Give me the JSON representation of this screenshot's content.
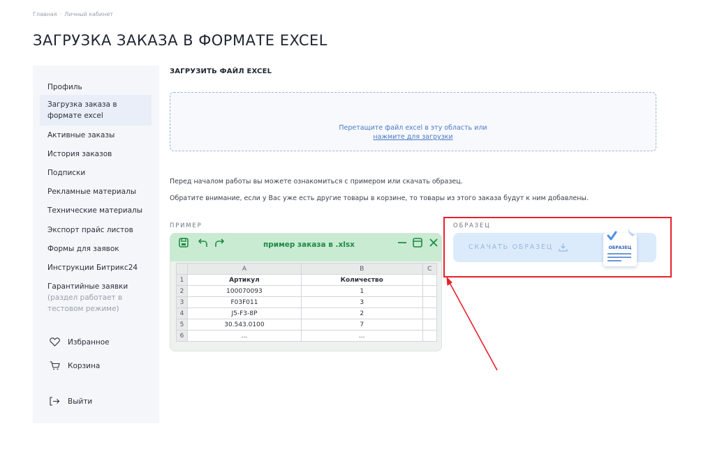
{
  "breadcrumb": {
    "home": "Главная",
    "separator": "·",
    "current": "Личный кабинет"
  },
  "page_title": "ЗАГРУЗКА ЗАКАЗА В ФОРМАТЕ EXCEL",
  "sidebar": {
    "items": [
      {
        "label": "Профиль"
      },
      {
        "label_line1": "Загрузка заказа в",
        "label_line2": "формате excel"
      },
      {
        "label": "Активные заказы"
      },
      {
        "label": "История заказов"
      },
      {
        "label": "Подписки"
      },
      {
        "label": "Рекламные материалы"
      },
      {
        "label": "Технические материалы"
      },
      {
        "label": "Экспорт прайс листов"
      },
      {
        "label": "Формы для заявок"
      },
      {
        "label": "Инструкции Битрикс24"
      },
      {
        "label": "Гарантийные заявки",
        "note_line1": "(раздел работает в",
        "note_line2": "тестовом режиме)"
      }
    ],
    "favorites": "Избранное",
    "cart": "Корзина",
    "logout": "Выйти"
  },
  "upload": {
    "section_title": "ЗАГРУЗИТЬ ФАЙЛ EXCEL",
    "dropzone_text": "Перетащите файл excel в эту область или",
    "dropzone_link": "нажмите для загрузки"
  },
  "info": {
    "line1": "Перед началом работы вы можете ознакомиться с примером или скачать образец.",
    "line2": "Обратите внимание, если у Вас уже есть другие товары в корзине, то товары из этого заказа будут к ним добавлены."
  },
  "example": {
    "label": "ПРИМЕР",
    "window_title": "пример заказа в .xlsx",
    "columns": [
      "A",
      "B",
      "C"
    ],
    "rows": [
      {
        "n": "1",
        "a": "Артикул",
        "b": "Количество",
        "c": ""
      },
      {
        "n": "2",
        "a": "100070093",
        "b": "1",
        "c": ""
      },
      {
        "n": "3",
        "a": "F03F011",
        "b": "3",
        "c": ""
      },
      {
        "n": "4",
        "a": "J5-F3-8P",
        "b": "2",
        "c": ""
      },
      {
        "n": "5",
        "a": "30.543.0100",
        "b": "7",
        "c": ""
      },
      {
        "n": "6",
        "a": "...",
        "b": "...",
        "c": ""
      }
    ]
  },
  "sample": {
    "label": "ОБРАЗЕЦ",
    "download_label": "СКАЧАТЬ ОБРАЗЕЦ",
    "doc_label": "ОБРАЗЕЦ"
  },
  "colors": {
    "accent_blue": "#4a78c6",
    "excel_green": "#1f8a45",
    "highlight_red": "#e8202a"
  }
}
